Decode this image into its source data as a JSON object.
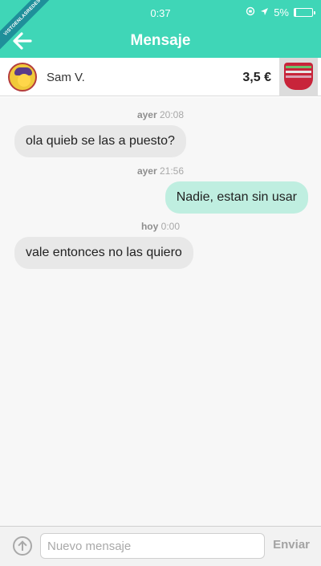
{
  "watermark": {
    "text": "VISTOENLASREDES"
  },
  "status_bar": {
    "time": "0:37",
    "battery": "5%"
  },
  "nav": {
    "title": "Mensaje"
  },
  "product": {
    "seller": "Sam V.",
    "price": "3,5 €"
  },
  "messages": [
    {
      "timestamp_day": "ayer",
      "timestamp_time": "20:08",
      "side": "in",
      "text": "ola quieb se las a puesto?"
    },
    {
      "timestamp_day": "ayer",
      "timestamp_time": "21:56",
      "side": "out",
      "text": "Nadie, estan sin usar"
    },
    {
      "timestamp_day": "hoy",
      "timestamp_time": "0:00",
      "side": "in",
      "text": "vale entonces no las quiero"
    }
  ],
  "composer": {
    "placeholder": "Nuevo mensaje",
    "send_label": "Enviar"
  },
  "colors": {
    "header": "#3fd6b7",
    "outgoing_bubble": "#bfeee0",
    "incoming_bubble": "#e8e8e8"
  }
}
